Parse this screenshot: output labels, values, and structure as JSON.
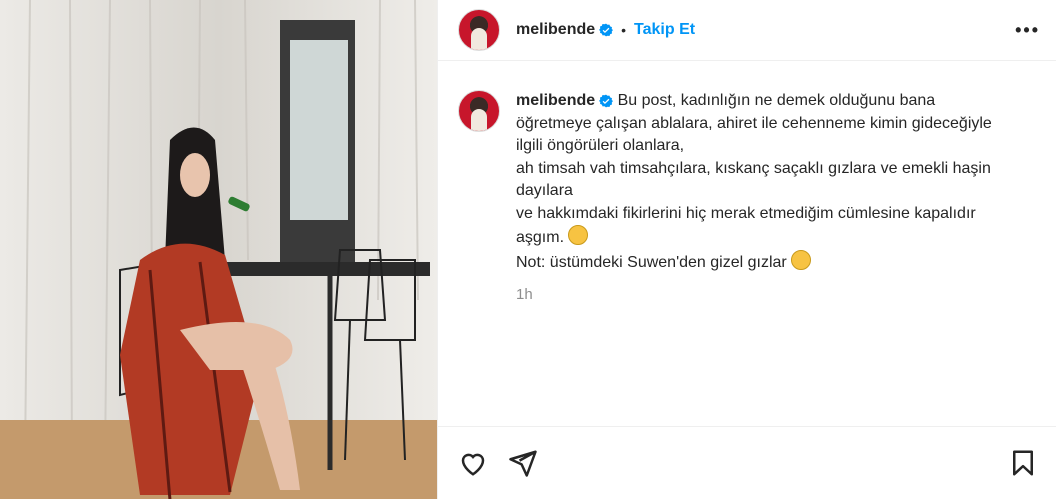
{
  "post": {
    "username": "melibende",
    "follow_label": "Takip Et",
    "separator": "•",
    "more_label": "•••"
  },
  "caption": {
    "username": "melibende",
    "line1": "Bu post, kadınlığın ne demek olduğunu bana öğretmeye çalışan ablalara, ahiret ile cehenneme kimin gideceğiyle ilgili öngörüleri olanlara,",
    "line2": "ah timsah vah timsahçılara, kıskanç saçaklı gızlara ve emekli haşin dayılara",
    "line3": "ve hakkımdaki fikirlerini hiç merak etmediğim cümlesine kapalıdır aşgım.",
    "line4": "Not: üstümdeki Suwen'den gizel gızlar",
    "time": "1h"
  },
  "colors": {
    "accent": "#0095f6",
    "text": "#262626",
    "muted": "#8e8e8e",
    "verified": "#0095f6"
  },
  "icons": [
    "heart-icon",
    "share-icon",
    "bookmark-icon",
    "more-icon",
    "verified-badge-icon"
  ]
}
